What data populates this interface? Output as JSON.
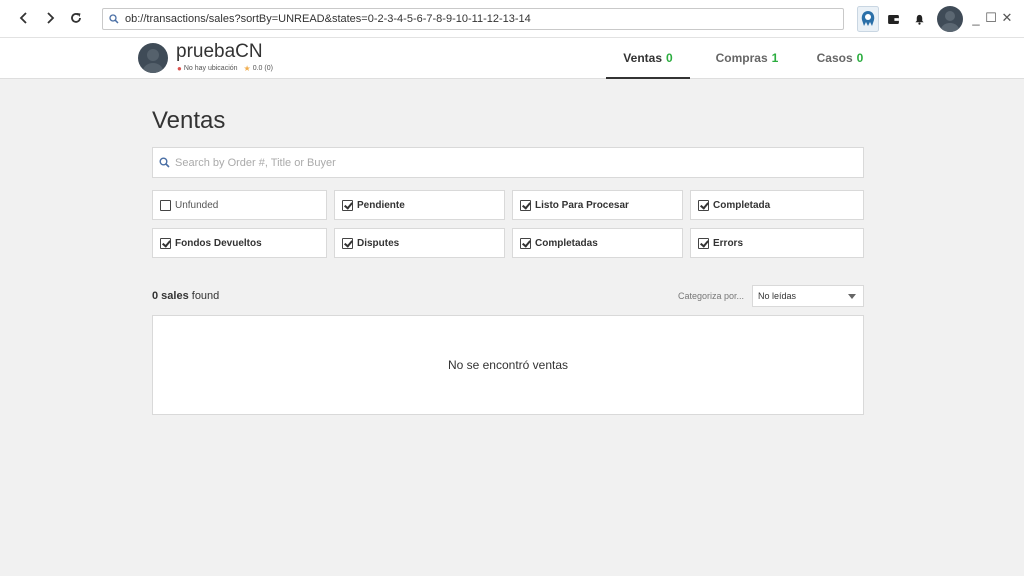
{
  "browser": {
    "url": "ob://transactions/sales?sortBy=UNREAD&states=0-2-3-4-5-6-7-8-9-10-11-12-13-14",
    "icons": [
      "back-icon",
      "forward-icon",
      "reload-icon",
      "search-icon",
      "openbazaar-icon",
      "wallet-icon",
      "bell-icon",
      "avatar",
      "minimize-icon",
      "maximize-icon",
      "close-icon"
    ],
    "minimize_glyph": "_",
    "maximize_glyph": "☐",
    "close_glyph": "✕"
  },
  "profile": {
    "name": "pruebaCN",
    "location": "No hay ubicación",
    "rating": "0.0 (0)"
  },
  "tabs": [
    {
      "label": "Ventas",
      "count": "0",
      "active": true
    },
    {
      "label": "Compras",
      "count": "1",
      "active": false
    },
    {
      "label": "Casos",
      "count": "0",
      "active": false
    }
  ],
  "main": {
    "title": "Ventas",
    "search_placeholder": "Search by Order #, Title or Buyer",
    "filters": [
      {
        "label": "Unfunded",
        "checked": false
      },
      {
        "label": "Pendiente",
        "checked": true
      },
      {
        "label": "Listo Para Procesar",
        "checked": true
      },
      {
        "label": "Completada",
        "checked": true
      },
      {
        "label": "Fondos Devueltos",
        "checked": true
      },
      {
        "label": "Disputes",
        "checked": true
      },
      {
        "label": "Completadas",
        "checked": true
      },
      {
        "label": "Errors",
        "checked": true
      }
    ],
    "count_bold": "0 sales",
    "count_rest": " found",
    "sort_label": "Categoriza por...",
    "sort_value": "No leídas",
    "empty_message": "No se encontró ventas"
  },
  "colors": {
    "accent_green": "#2bad3f",
    "background": "#f1f1f1",
    "star": "#f0ad4e"
  }
}
